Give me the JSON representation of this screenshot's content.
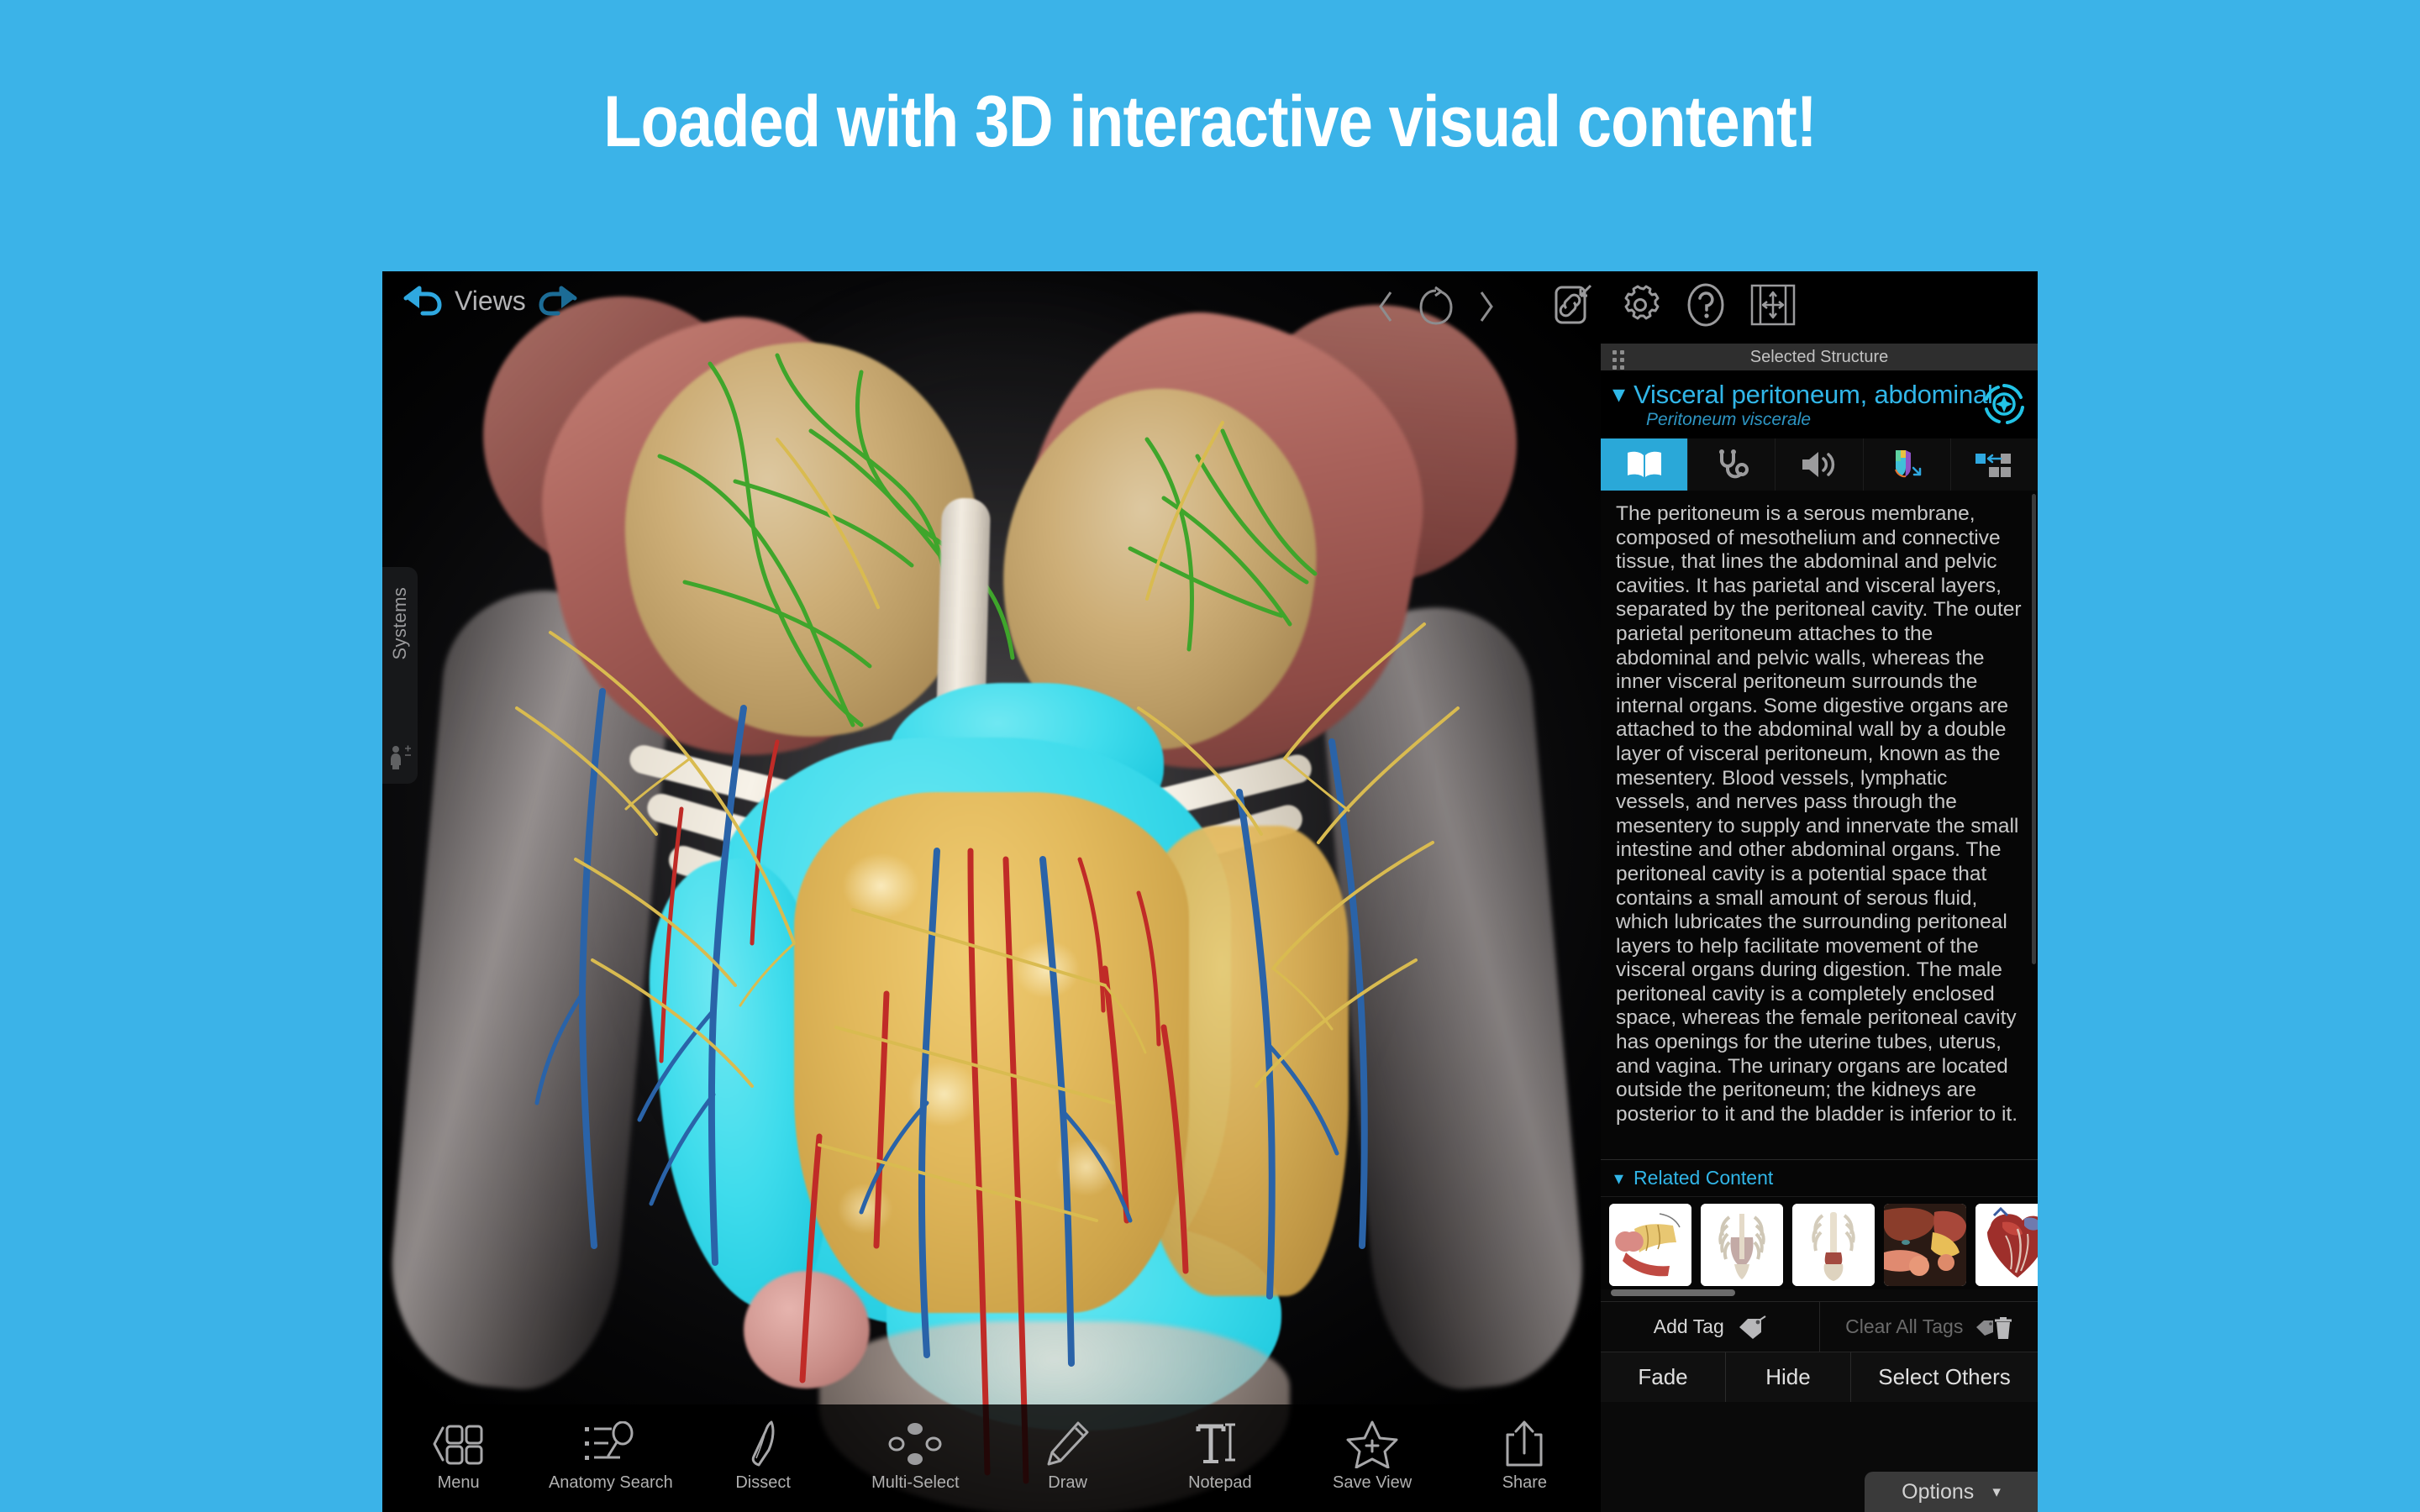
{
  "banner": {
    "headline": "Loaded with 3D interactive visual content!",
    "background_color": "#3BB3E8"
  },
  "app": {
    "topbar": {
      "views_label": "Views",
      "undo_icon": "undo-arrow-icon",
      "redo_icon": "redo-arrow-icon",
      "prev_icon": "chevron-left-icon",
      "reset_icon": "rotate-reset-icon",
      "next_icon": "chevron-right-icon",
      "link_icon": "link-grab-icon",
      "settings_icon": "gear-icon",
      "help_icon": "help-question-icon",
      "fullscreen_icon": "fullscreen-expand-icon"
    },
    "side_tab": {
      "label": "Systems",
      "icon": "body-systems-icon"
    },
    "panel": {
      "titlebar": "Selected Structure",
      "grip_icon": "drag-grip-icon",
      "structure_name": "Visceral peritoneum, abdominal",
      "structure_latin": "Peritoneum viscerale",
      "collapse_icon": "chevron-down-icon",
      "target_icon": "target-locate-icon",
      "tabs": [
        {
          "name": "definition",
          "icon": "book-icon",
          "active": true
        },
        {
          "name": "clinical",
          "icon": "stethoscope-icon",
          "active": false
        },
        {
          "name": "pronunciation",
          "icon": "speaker-icon",
          "active": false
        },
        {
          "name": "highlight",
          "icon": "colored-shield-icon",
          "active": false
        },
        {
          "name": "select-parts",
          "icon": "grid-select-icon",
          "active": false
        }
      ],
      "body_text": "The peritoneum is a serous membrane, composed of mesothelium and connective tissue, that lines the abdominal and pelvic cavities. It has parietal and visceral layers, separated by the peritoneal cavity. The outer parietal peritoneum attaches to the abdominal and pelvic walls, whereas the inner visceral peritoneum surrounds the internal organs. Some digestive organs are attached to the abdominal wall by a double layer of visceral peritoneum, known as the mesentery. Blood vessels, lymphatic vessels, and nerves pass through the mesentery to supply and innervate the small intestine and other abdominal organs. The peritoneal cavity is a potential space that contains a small amount of serous fluid, which lubricates the surrounding peritoneal layers to help facilitate movement of the visceral organs during digestion. The male peritoneal cavity is a completely enclosed space, whereas the female peritoneal cavity has openings for the uterine tubes, uterus, and vagina. The urinary organs are located outside the peritoneum; the kidneys are posterior to it and the bladder is inferior to it.",
      "related_content_label": "Related Content",
      "related_chevron_icon": "chevron-down-icon",
      "thumbnails": [
        {
          "name": "thumb-intestine-mesentery"
        },
        {
          "name": "thumb-ribcage-anterior"
        },
        {
          "name": "thumb-ribcage-posterior"
        },
        {
          "name": "thumb-liver-stomach"
        },
        {
          "name": "thumb-heart"
        }
      ],
      "add_tag_label": "Add Tag",
      "add_tag_icon": "tag-icon",
      "clear_tags_label": "Clear All Tags",
      "clear_tags_icon": "tag-trash-icon",
      "actions": [
        {
          "label": "Fade",
          "name": "fade-button"
        },
        {
          "label": "Hide",
          "name": "hide-button"
        },
        {
          "label": "Select Others",
          "name": "select-others-button"
        }
      ],
      "options_label": "Options",
      "options_chevron_icon": "chevron-down-icon"
    },
    "bottombar": [
      {
        "label": "Menu",
        "icon": "grid-menu-icon"
      },
      {
        "label": "Anatomy Search",
        "icon": "search-list-icon"
      },
      {
        "label": "Dissect",
        "icon": "scalpel-icon"
      },
      {
        "label": "Multi-Select",
        "icon": "multi-select-dots-icon"
      },
      {
        "label": "Draw",
        "icon": "pencil-icon"
      },
      {
        "label": "Notepad",
        "icon": "text-cursor-icon"
      },
      {
        "label": "Save View",
        "icon": "star-plus-icon"
      },
      {
        "label": "Share",
        "icon": "share-upload-icon"
      }
    ],
    "viewport": {
      "name": "3d-anatomy-viewport",
      "colors": {
        "selected_structure": "#3FDCEC",
        "omentum": "#E2B95C",
        "muscle": "#A8615A",
        "artery": "#C02B27",
        "vein": "#2F6FB5",
        "nerve": "#E0C04F",
        "lymphatic": "#3FA52B",
        "bone": "#EFE8DA"
      }
    }
  }
}
